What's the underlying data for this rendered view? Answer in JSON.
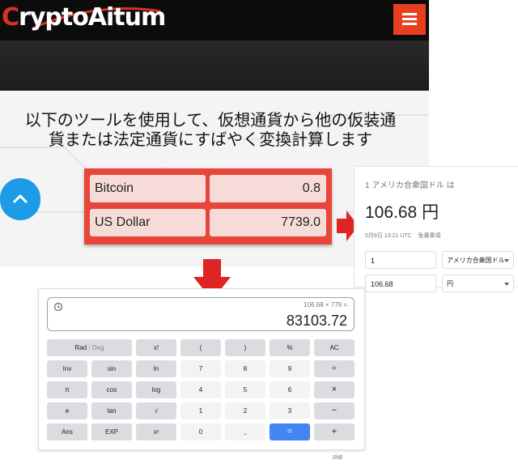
{
  "site": {
    "logo_text": "CryptoAitum",
    "headline_line1": "以下のツールを使用して、仮想通貨から他の仮装通",
    "headline_line2": "貨または法定通貨にすばやく変換計算します"
  },
  "converter": {
    "from_currency": "Bitcoin",
    "from_amount": "0.8",
    "to_currency": "US Dollar",
    "to_amount": "7739.0"
  },
  "google": {
    "rate_label": "1 アメリカ合衆国ドル は",
    "result": "106.68 円",
    "date": "5月9日 13:21 UTC",
    "disclaimer": "免責事項",
    "amount1": "1",
    "currency1": "アメリカ合衆国ドル",
    "amount2": "106.68",
    "currency2": "円"
  },
  "calculator": {
    "expression": "106.68 × 779 =",
    "value": "83103.72",
    "keys": {
      "rad": "Rad",
      "deg": "Deg",
      "fact": "x!",
      "lparen": "(",
      "rparen": ")",
      "percent": "%",
      "ac": "AC",
      "inv": "Inv",
      "sin": "sin",
      "ln": "ln",
      "seven": "7",
      "eight": "8",
      "nine": "9",
      "divide": "÷",
      "pi": "π",
      "cos": "cos",
      "log": "log",
      "four": "4",
      "five": "5",
      "six": "6",
      "multiply": "×",
      "e": "e",
      "tan": "tan",
      "sqrt": "√",
      "one": "1",
      "two": "2",
      "three": "3",
      "minus": "−",
      "ans": "Ans",
      "exp": "EXP",
      "pow": "xʸ",
      "zero": "0",
      "dot": ".",
      "equals": "=",
      "plus": "+"
    },
    "footer": "詳細"
  },
  "colors": {
    "brand_red": "#e8401f",
    "converter_red": "#e8463a",
    "scroll_blue": "#1e9be6",
    "equals_blue": "#4285f4"
  }
}
